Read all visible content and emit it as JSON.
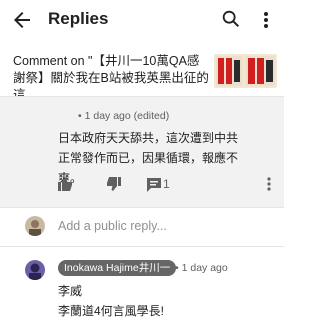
{
  "app_bar": {
    "title": "Replies",
    "back_icon": "arrow-left-icon",
    "search_icon": "search-icon",
    "more_icon": "more-vert-icon"
  },
  "context": {
    "text": "Comment on \"【井川一10萬QA感謝祭】關於我在B站被我英黑出征的這...",
    "thumbnail_icon": "video-thumbnail"
  },
  "parent_reply": {
    "meta": "• 1 day ago (edited)",
    "body": "日本政府天天舔共，這次遭到中共正常發作而已，因果循環，報應不爽。",
    "dislike_count": "",
    "reply_count": "1"
  },
  "compose": {
    "placeholder": "Add a public reply..."
  },
  "reply": {
    "author": "Inokawa Hajime井川一",
    "time": "• 1 day ago",
    "line1": "李威",
    "line2": "李蘭道4何言風學長!"
  },
  "colors": {
    "background": "#ffffff",
    "highlight": "#f2f2f2",
    "author_badge": "#666666",
    "thumb_red": "#d11f1f"
  }
}
